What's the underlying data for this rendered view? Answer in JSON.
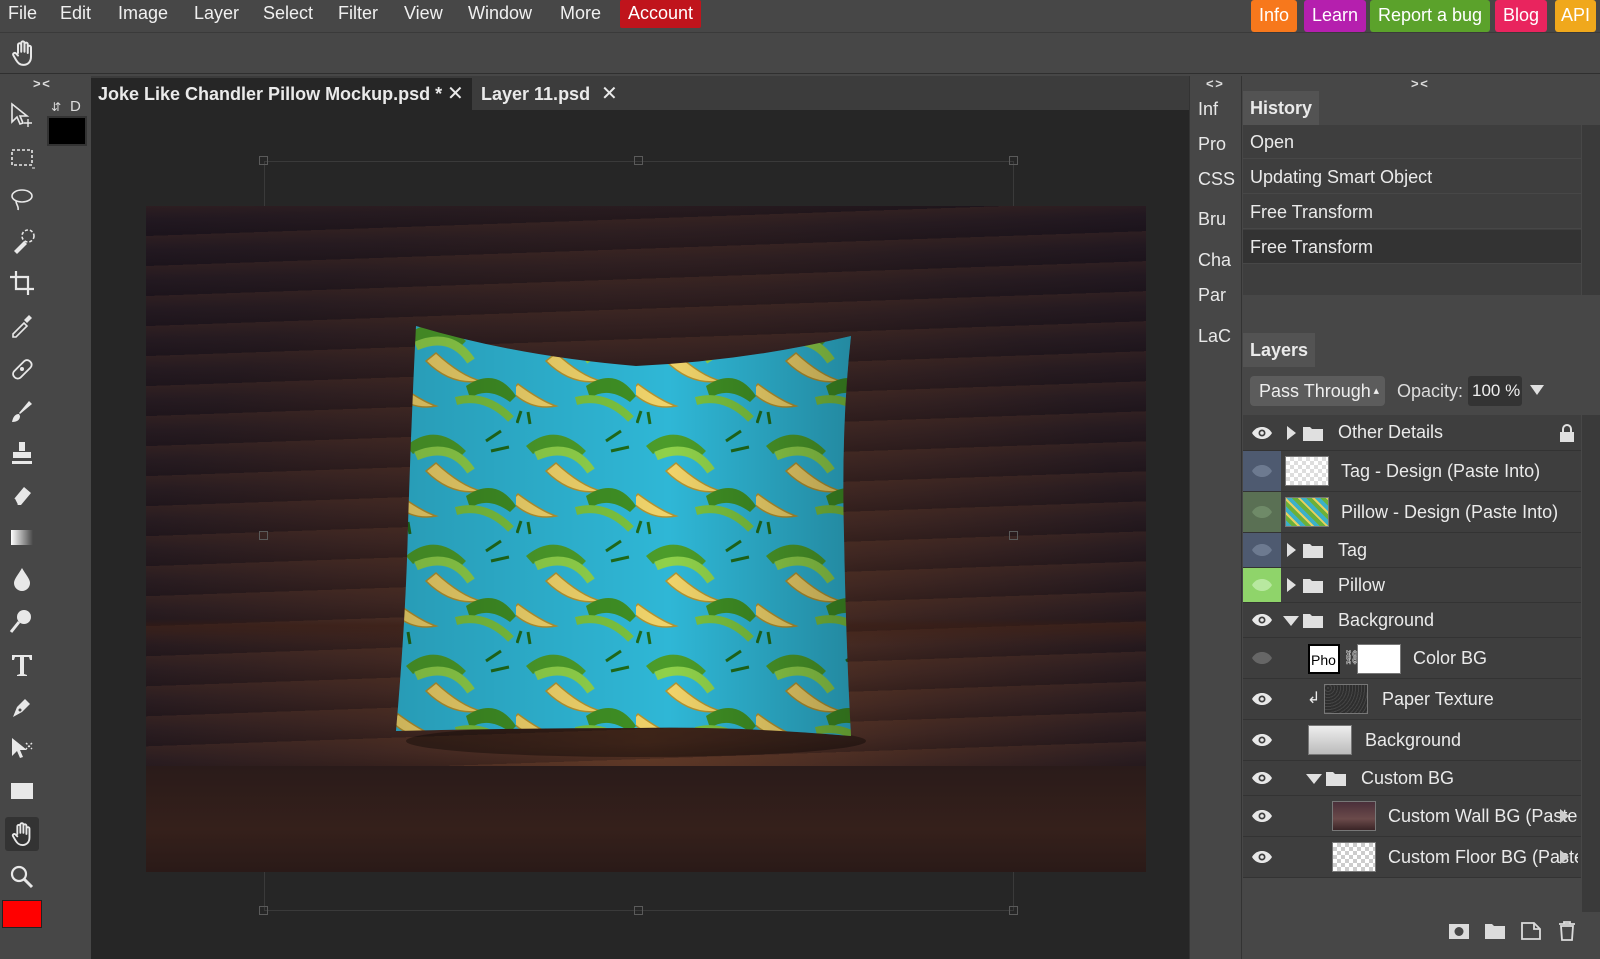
{
  "menubar": {
    "items": [
      "File",
      "Edit",
      "Image",
      "Layer",
      "Select",
      "Filter",
      "View",
      "Window",
      "More"
    ],
    "account": "Account",
    "buttons": [
      {
        "label": "Info",
        "color": "#f7781c"
      },
      {
        "label": "Learn",
        "color": "#b51fae"
      },
      {
        "label": "Report a bug",
        "color": "#5ba22b"
      },
      {
        "label": "Blog",
        "color": "#e9245e"
      },
      {
        "label": "API",
        "color": "#f0a81c"
      }
    ]
  },
  "toolbar": {
    "color_swap_label": "⇵",
    "default_colors_label": "D",
    "foreground_color": "#000000",
    "secondary_color": "#ff0000",
    "tools": [
      "move-tool",
      "marquee-tool",
      "lasso-tool",
      "quick-select-tool",
      "crop-tool",
      "eyedropper-tool",
      "healing-tool",
      "brush-tool",
      "stamp-tool",
      "eraser-tool",
      "gradient-tool",
      "blur-tool",
      "dodge-tool",
      "type-tool",
      "pen-tool",
      "path-select-tool",
      "shape-tool",
      "hand-tool",
      "zoom-tool"
    ],
    "active_tool": "hand-tool"
  },
  "panel_collapse": {
    "left": ">  <",
    "middle": "<  >",
    "right": ">  <"
  },
  "document_tabs": [
    {
      "label": "Joke Like Chandler Pillow Mockup.psd *",
      "close": "✕",
      "active": true
    },
    {
      "label": "Layer 11.psd",
      "close": "✕",
      "active": false
    }
  ],
  "side_tabs": [
    "Inf",
    "Pro",
    "CSS",
    "Bru",
    "Cha",
    "Par",
    "LaC"
  ],
  "history": {
    "title": "History",
    "items": [
      "Open",
      "Updating Smart Object",
      "Free Transform",
      "Free Transform"
    ]
  },
  "layers": {
    "title": "Layers",
    "blend_mode": "Pass Through",
    "opacity_label": "Opacity:",
    "opacity_value": "100 %",
    "rows": [
      {
        "name": "Other Details",
        "kind": "folder",
        "expanded": false,
        "locked": true
      },
      {
        "name": "Tag - Design (Paste Into)",
        "kind": "smart"
      },
      {
        "name": "Pillow - Design (Paste Into)",
        "kind": "smart"
      },
      {
        "name": "Tag",
        "kind": "folder",
        "expanded": false
      },
      {
        "name": "Pillow",
        "kind": "folder",
        "expanded": false
      },
      {
        "name": "Background",
        "kind": "folder",
        "expanded": true
      },
      {
        "name": "Color BG",
        "kind": "fill",
        "thumb_label": "Pho"
      },
      {
        "name": "Paper Texture",
        "kind": "clipped"
      },
      {
        "name": "Background",
        "kind": "layer"
      },
      {
        "name": "Custom BG",
        "kind": "folder",
        "expanded": true
      },
      {
        "name": "Custom Wall BG (Paste I",
        "kind": "smart"
      },
      {
        "name": "Custom Floor BG (Paste",
        "kind": "smart"
      }
    ]
  }
}
